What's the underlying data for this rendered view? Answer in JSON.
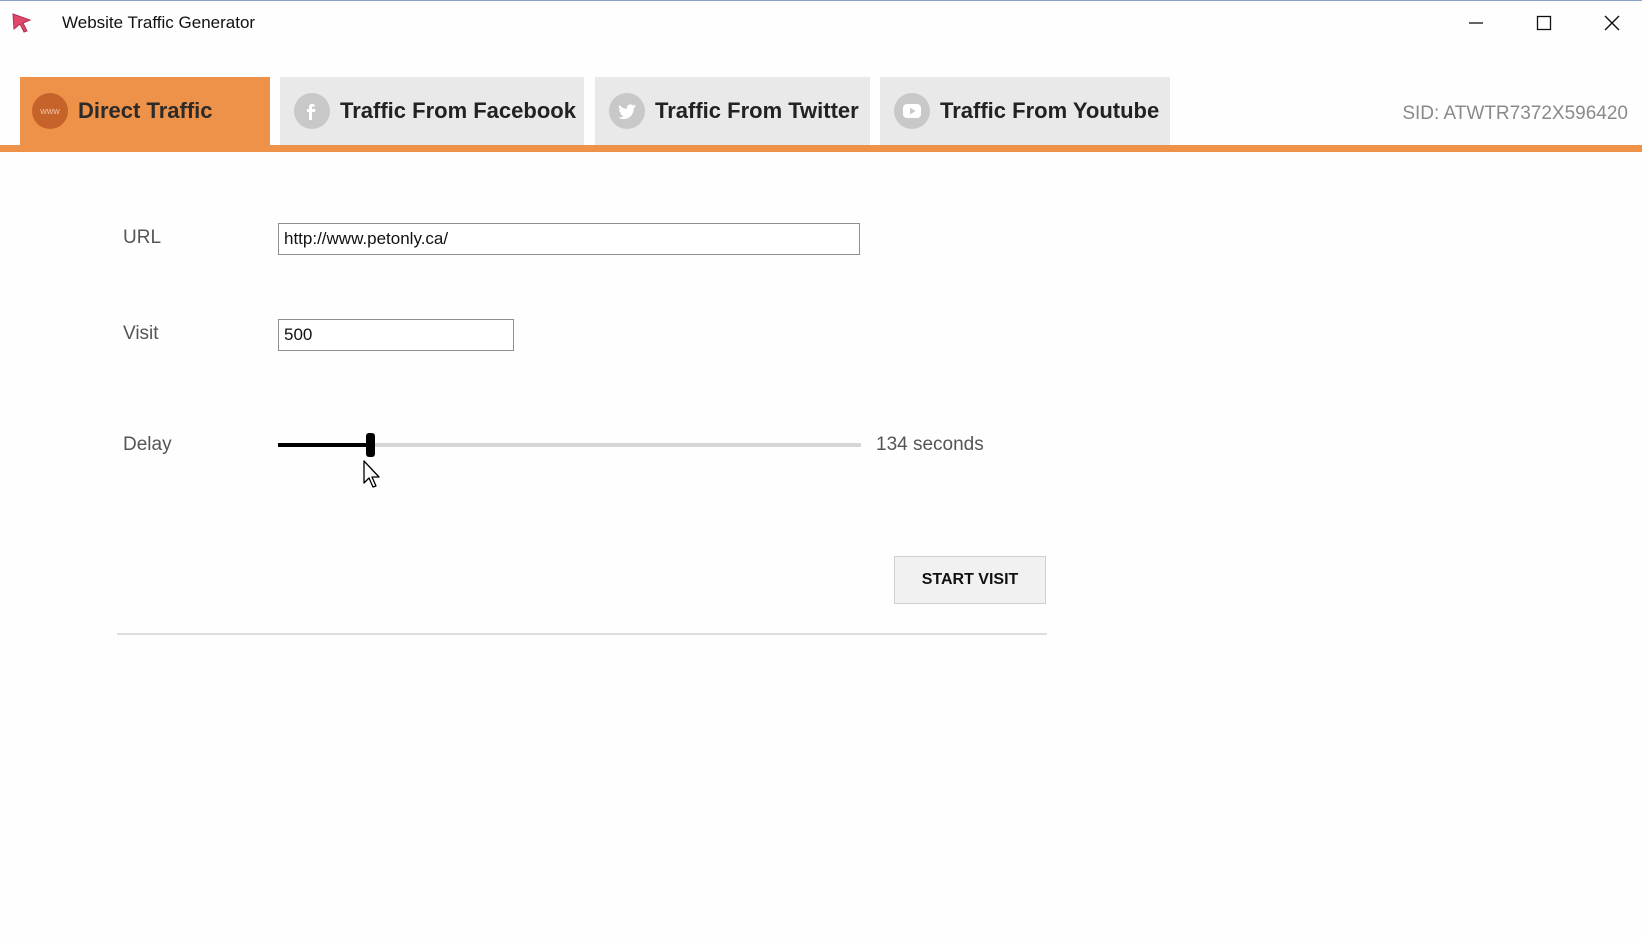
{
  "window": {
    "title": "Website Traffic Generator"
  },
  "tabs": [
    {
      "label": "Direct Traffic",
      "icon": "www-globe-icon",
      "active": true
    },
    {
      "label": "Traffic From Facebook",
      "icon": "facebook-icon",
      "active": false
    },
    {
      "label": "Traffic From Twitter",
      "icon": "twitter-icon",
      "active": false
    },
    {
      "label": "Traffic From Youtube",
      "icon": "youtube-icon",
      "active": false
    }
  ],
  "sid": "SID: ATWTR7372X596420",
  "form": {
    "url_label": "URL",
    "url_value": "http://www.petonly.ca/",
    "visit_label": "Visit",
    "visit_value": "500",
    "delay_label": "Delay",
    "delay_value_text": "134 seconds",
    "delay_fraction": 0.157,
    "start_button": "START VISIT"
  },
  "colors": {
    "accent": "#ef9249",
    "accent_dark": "#c6632a",
    "tab_inactive": "#e9e9e9"
  }
}
